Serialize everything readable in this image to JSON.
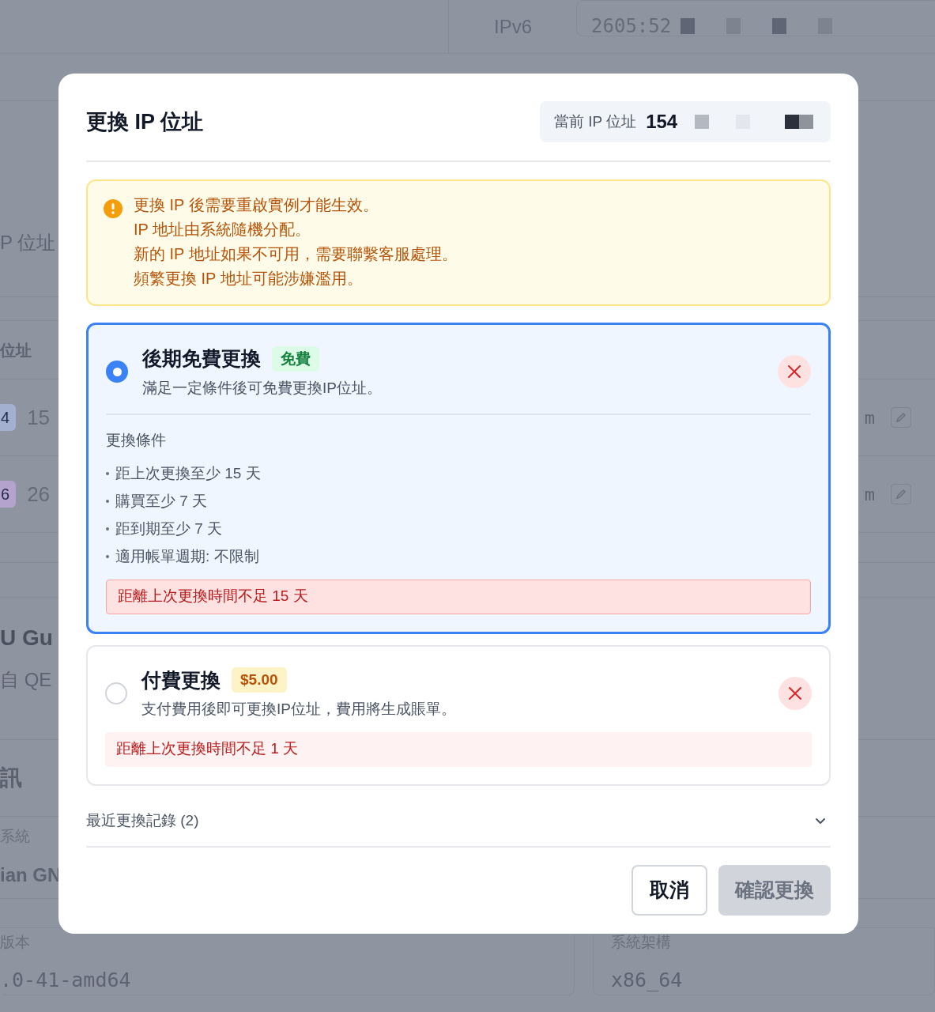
{
  "background": {
    "ipv6": {
      "label": "IPv6",
      "value": "2605:52"
    },
    "section_label": "P 位址",
    "table_header": "位址",
    "ip_rows": [
      {
        "badge": "4",
        "color": "#a3b0d0",
        "value": "15",
        "domain": "m"
      },
      {
        "badge": "6",
        "color": "#b4a3cc",
        "value": "26",
        "domain": "m"
      }
    ],
    "guest_title": "U Gu",
    "guest_subtitle": "自 QE",
    "info_title": "訊",
    "os_label": "系統",
    "os_value": "ian GN",
    "kernel_label": "版本",
    "kernel_value": ".0-41-amd64",
    "arch_label": "系統架構",
    "arch_value": "x86_64"
  },
  "dialog": {
    "title": "更換 IP 位址",
    "current_ip": {
      "label": "當前 IP 位址",
      "value": "154"
    },
    "notice": [
      "更換 IP 後需要重啟實例才能生效。",
      "IP 地址由系統隨機分配。",
      "新的 IP 地址如果不可用，需要聯繫客服處理。",
      "頻繁更換 IP 地址可能涉嫌濫用。"
    ],
    "options": [
      {
        "kind": "free",
        "selected": true,
        "title": "後期免費更換",
        "badge": "免費",
        "description": "滿足一定條件後可免費更換IP位址。",
        "conditions_title": "更換條件",
        "conditions": [
          "距上次更換至少 15 天",
          "購買至少 7 天",
          "距到期至少 7 天",
          "適用帳單週期: 不限制"
        ],
        "error": "距離上次更換時間不足 15 天"
      },
      {
        "kind": "paid",
        "selected": false,
        "title": "付費更換",
        "badge": "$5.00",
        "description": "支付費用後即可更換IP位址，費用將生成賬單。",
        "error": "距離上次更換時間不足 1 天"
      }
    ],
    "history": {
      "label": "最近更換記錄 (2)",
      "expanded": false
    },
    "buttons": [
      {
        "kind": "secondary",
        "label": "取消",
        "disabled": false
      },
      {
        "kind": "primary",
        "label": "確認更換",
        "disabled": true
      }
    ]
  }
}
